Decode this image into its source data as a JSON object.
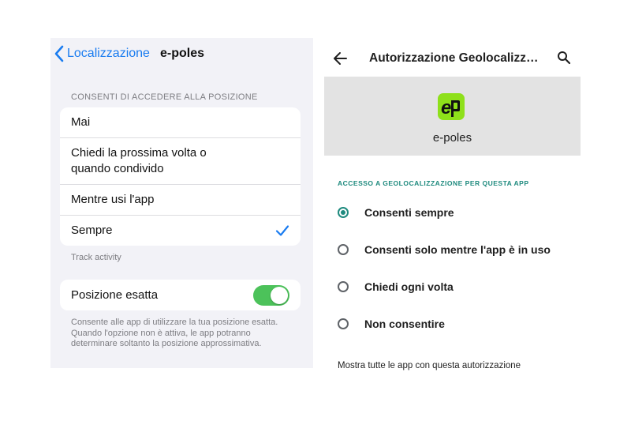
{
  "ios": {
    "back_label": "Localizzazione",
    "title": "e-poles",
    "section_header": "CONSENTI DI ACCEDERE ALLA POSIZIONE",
    "options": [
      {
        "label": "Mai"
      },
      {
        "label": "Chiedi la prossima volta o quando condivido"
      },
      {
        "label": "Mentre usi l'app"
      },
      {
        "label": "Sempre",
        "selected": true
      }
    ],
    "footnote": "Track activity",
    "precise_label": "Posizione esatta",
    "precise_on": true,
    "precise_desc": "Consente alle app di utilizzare la tua posizione esatta. Quando l'opzione non è attiva, le app potranno determinare soltanto la posizione approssimativa.",
    "accent_color": "#1a7cf0",
    "toggle_color": "#4cc25a"
  },
  "android": {
    "title": "Autorizzazione Geolocalizz…",
    "app_name": "e-poles",
    "app_icon_text": "ep",
    "section_header": "ACCESSO A GEOLOCALIZZAZIONE PER QUESTA APP",
    "options": [
      {
        "label": "Consenti sempre",
        "selected": true
      },
      {
        "label": "Consenti solo mentre l'app è in uso",
        "selected": false
      },
      {
        "label": "Chiedi ogni volta",
        "selected": false
      },
      {
        "label": "Non consentire",
        "selected": false
      }
    ],
    "footer_link": "Mostra tutte le app con questa autorizzazione",
    "accent_color": "#1e8a7e",
    "icon_color": "#8ee01a"
  }
}
